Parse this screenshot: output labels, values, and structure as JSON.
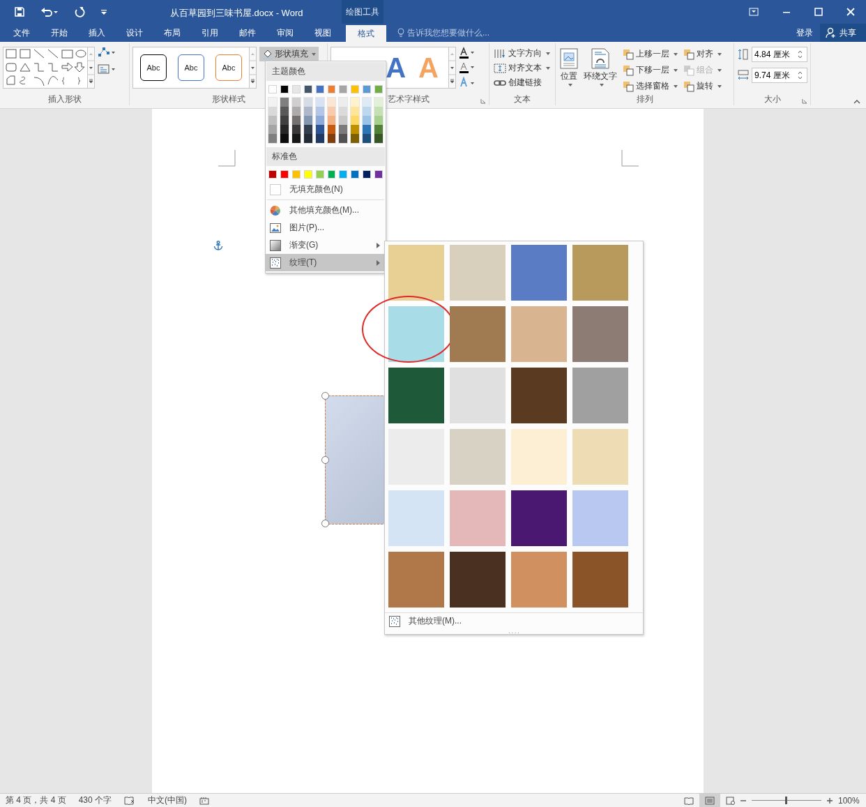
{
  "title_bar": {
    "title": "从百草园到三味书屋.docx - Word",
    "context_tab": "绘图工具"
  },
  "ribbon_tabs": [
    {
      "label": "文件",
      "selected": false
    },
    {
      "label": "开始",
      "selected": false
    },
    {
      "label": "插入",
      "selected": false
    },
    {
      "label": "设计",
      "selected": false
    },
    {
      "label": "布局",
      "selected": false
    },
    {
      "label": "引用",
      "selected": false
    },
    {
      "label": "邮件",
      "selected": false
    },
    {
      "label": "审阅",
      "selected": false
    },
    {
      "label": "视图",
      "selected": false
    },
    {
      "label": "格式",
      "selected": true
    }
  ],
  "tell_me": {
    "placeholder": "告诉我您想要做什么..."
  },
  "account": {
    "sign_in": "登录",
    "share": "共享"
  },
  "ribbon": {
    "insert_shapes": {
      "label": "插入形状"
    },
    "shape_styles": {
      "label": "形状样式",
      "samples": [
        {
          "text": "Abc",
          "color": "#000000"
        },
        {
          "text": "Abc",
          "color": "#4472c4"
        },
        {
          "text": "Abc",
          "color": "#ed7d31"
        }
      ],
      "fill_button": "形状填充"
    },
    "wordart_styles": {
      "label": "艺术字样式",
      "samples": [
        {
          "text": "A",
          "color": "#4472c4"
        },
        {
          "text": "A",
          "color": "#f4a460"
        }
      ]
    },
    "text": {
      "label": "文本",
      "items": [
        "文字方向",
        "对齐文本",
        "创建链接"
      ]
    },
    "arrange": {
      "label": "排列",
      "big_buttons": [
        "位置",
        "环绕文字"
      ],
      "items": [
        {
          "label": "上移一层",
          "disabled": false
        },
        {
          "label": "下移一层",
          "disabled": false
        },
        {
          "label": "选择窗格",
          "disabled": false
        },
        {
          "label": "对齐",
          "disabled": false
        },
        {
          "label": "组合",
          "disabled": true
        },
        {
          "label": "旋转",
          "disabled": false
        }
      ]
    },
    "size": {
      "label": "大小",
      "height": "4.84 厘米",
      "width": "9.74 厘米"
    }
  },
  "fill_menu": {
    "theme_header": "主题颜色",
    "theme_colors": [
      {
        "color": "#ffffff"
      },
      {
        "color": "#000000"
      },
      {
        "color": "#e7e6e6"
      },
      {
        "color": "#44546a"
      },
      {
        "color": "#4472c4"
      },
      {
        "color": "#ed7d31"
      },
      {
        "color": "#a5a5a5"
      },
      {
        "color": "#ffc000"
      },
      {
        "color": "#5b9bd5"
      },
      {
        "color": "#70ad47"
      }
    ],
    "shades": [
      {
        "tints": [
          {
            "color": "#f2f2f2"
          },
          {
            "color": "#d9d9d9"
          },
          {
            "color": "#bfbfbf"
          },
          {
            "color": "#a6a6a6"
          },
          {
            "color": "#7f7f7f"
          }
        ]
      },
      {
        "tints": [
          {
            "color": "#7f7f7f"
          },
          {
            "color": "#595959"
          },
          {
            "color": "#404040"
          },
          {
            "color": "#262626"
          },
          {
            "color": "#0d0d0d"
          }
        ]
      },
      {
        "tints": [
          {
            "color": "#d0cece"
          },
          {
            "color": "#aeabab"
          },
          {
            "color": "#757171"
          },
          {
            "color": "#3a3838"
          },
          {
            "color": "#171616"
          }
        ]
      },
      {
        "tints": [
          {
            "color": "#d6dce4"
          },
          {
            "color": "#adb9ca"
          },
          {
            "color": "#8497b0"
          },
          {
            "color": "#333f4f"
          },
          {
            "color": "#222a35"
          }
        ]
      },
      {
        "tints": [
          {
            "color": "#d9e2f3"
          },
          {
            "color": "#b4c6e7"
          },
          {
            "color": "#8eaadb"
          },
          {
            "color": "#2f5496"
          },
          {
            "color": "#1f3864"
          }
        ]
      },
      {
        "tints": [
          {
            "color": "#fbe5d5"
          },
          {
            "color": "#f7cbac"
          },
          {
            "color": "#f4b183"
          },
          {
            "color": "#c55a11"
          },
          {
            "color": "#833c0b"
          }
        ]
      },
      {
        "tints": [
          {
            "color": "#ededed"
          },
          {
            "color": "#dbdbdb"
          },
          {
            "color": "#c9c9c9"
          },
          {
            "color": "#7b7b7b"
          },
          {
            "color": "#525252"
          }
        ]
      },
      {
        "tints": [
          {
            "color": "#fff2cc"
          },
          {
            "color": "#fee599"
          },
          {
            "color": "#ffd965"
          },
          {
            "color": "#bf9000"
          },
          {
            "color": "#7f6000"
          }
        ]
      },
      {
        "tints": [
          {
            "color": "#deebf6"
          },
          {
            "color": "#bdd7ee"
          },
          {
            "color": "#9cc3e5"
          },
          {
            "color": "#2e75b5"
          },
          {
            "color": "#1e4e79"
          }
        ]
      },
      {
        "tints": [
          {
            "color": "#e2efd9"
          },
          {
            "color": "#c5e0b3"
          },
          {
            "color": "#a8d08d"
          },
          {
            "color": "#538135"
          },
          {
            "color": "#375623"
          }
        ]
      }
    ],
    "standard_header": "标准色",
    "standard_colors": [
      {
        "color": "#c00000"
      },
      {
        "color": "#ff0000"
      },
      {
        "color": "#ffc000"
      },
      {
        "color": "#ffff00"
      },
      {
        "color": "#92d050"
      },
      {
        "color": "#00b050"
      },
      {
        "color": "#00b0f0"
      },
      {
        "color": "#0070c0"
      },
      {
        "color": "#002060"
      },
      {
        "color": "#7030a0"
      }
    ],
    "items": [
      {
        "kind": "no-fill",
        "label": "无填充颜色(N)",
        "selected": false
      },
      {
        "kind": "more-colors",
        "label": "其他填充颜色(M)...",
        "selected": false
      },
      {
        "kind": "picture",
        "label": "图片(P)...",
        "selected": false
      },
      {
        "kind": "gradient",
        "label": "渐变(G)",
        "selected": false
      },
      {
        "kind": "texture",
        "label": "纹理(T)",
        "selected": true
      }
    ]
  },
  "texture_menu": {
    "textures": [
      {
        "color": "#e8cf94",
        "circled": false
      },
      {
        "color": "#d8d0bc",
        "circled": false
      },
      {
        "color": "#5a7cc4",
        "circled": false
      },
      {
        "color": "#b89a5c",
        "circled": false
      },
      {
        "color": "#a8dde8",
        "circled": true
      },
      {
        "color": "#a07a50",
        "circled": false
      },
      {
        "color": "#d8b490",
        "circled": false
      },
      {
        "color": "#8c7c74",
        "circled": false
      },
      {
        "color": "#1e5a3a",
        "circled": false
      },
      {
        "color": "#e0e0e0",
        "circled": false
      },
      {
        "color": "#5a3a20",
        "circled": false
      },
      {
        "color": "#a0a0a0",
        "circled": false
      },
      {
        "color": "#ececec",
        "circled": false
      },
      {
        "color": "#d8d2c4",
        "circled": false
      },
      {
        "color": "#fcefd4",
        "circled": false
      },
      {
        "color": "#eedcb4",
        "circled": false
      },
      {
        "color": "#d4e4f4",
        "circled": false
      },
      {
        "color": "#e4b8b8",
        "circled": false
      },
      {
        "color": "#4a1870",
        "circled": false
      },
      {
        "color": "#b8c8f0",
        "circled": false
      },
      {
        "color": "#b07848",
        "circled": false
      },
      {
        "color": "#4a3020",
        "circled": false
      },
      {
        "color": "#d09060",
        "circled": false
      },
      {
        "color": "#8a5428",
        "circled": false
      }
    ],
    "more": "其他纹理(M)..."
  },
  "status_bar": {
    "page": "第 4 页，共 4 页",
    "words": "430 个字",
    "language": "中文(中国)",
    "views": [
      {
        "kind": "read",
        "selected": false
      },
      {
        "kind": "print",
        "selected": true
      },
      {
        "kind": "web",
        "selected": false
      }
    ],
    "zoom": {
      "level": 0.5,
      "reading": "100%"
    }
  }
}
